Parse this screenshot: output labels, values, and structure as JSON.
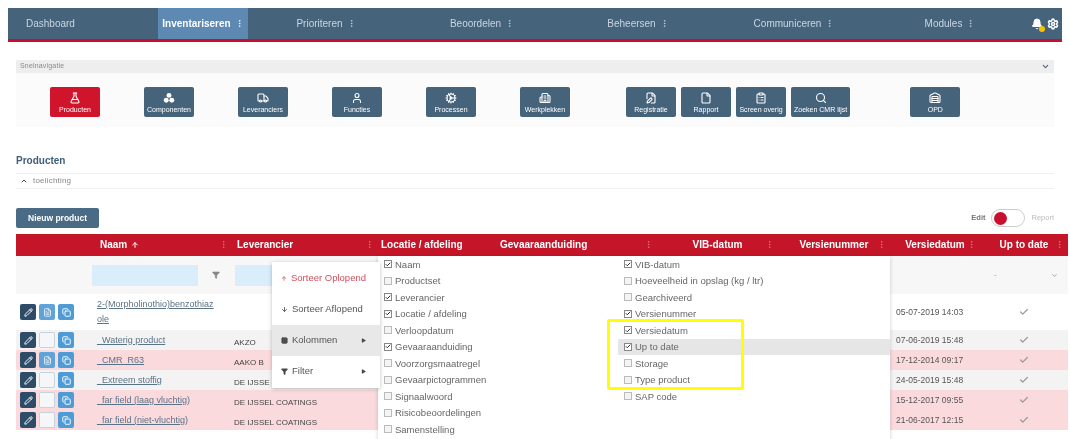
{
  "nav": {
    "items": [
      {
        "label": "Dashboard",
        "selected": false,
        "menu": false
      },
      {
        "label": "Inventariseren",
        "selected": true,
        "menu": true
      },
      {
        "label": "Prioriteren",
        "selected": false,
        "menu": true
      },
      {
        "label": "Beoordelen",
        "selected": false,
        "menu": true
      },
      {
        "label": "Beheersen",
        "selected": false,
        "menu": true
      },
      {
        "label": "Communiceren",
        "selected": false,
        "menu": true
      },
      {
        "label": "Modules",
        "selected": false,
        "menu": true
      }
    ],
    "notification": true
  },
  "quick_nav": {
    "title": "Snelnavigatie",
    "expanded": true,
    "groups": [
      [
        {
          "label": "Producten",
          "selected": true
        },
        {
          "label": "Componenten",
          "selected": false
        },
        {
          "label": "Leveranciers",
          "selected": false
        },
        {
          "label": "Functies",
          "selected": false
        },
        {
          "label": "Processen",
          "selected": false
        },
        {
          "label": "Werkplekken",
          "selected": false
        }
      ],
      [
        {
          "label": "Registratie",
          "selected": false
        },
        {
          "label": "Rapport",
          "selected": false
        },
        {
          "label": "Screen overig",
          "selected": false
        },
        {
          "label": "Zoeken CMR lijst",
          "selected": false
        }
      ],
      [
        {
          "label": "OPD",
          "selected": false
        }
      ]
    ]
  },
  "page": {
    "title": "Producten",
    "explanation": {
      "label": "toelichting",
      "expanded": true
    },
    "new_button": "Nieuw product",
    "toggle": {
      "left": "Edit",
      "right": "Report",
      "report_mode": false
    }
  },
  "table": {
    "columns": [
      {
        "label": "Naam",
        "sorted_ascending": true,
        "menu": true
      },
      {
        "label": "Leverancier",
        "menu": true
      },
      {
        "label": "Locatie / afdeling",
        "menu": false
      },
      {
        "label": "Gevaaraanduiding",
        "menu": true
      },
      {
        "label": "VIB-datum",
        "menu": true
      },
      {
        "label": "Versienummer",
        "menu": true
      },
      {
        "label": "Versiedatum",
        "menu": true
      },
      {
        "label": "Up to date",
        "menu": true
      }
    ],
    "up_to_date_filter": "-",
    "rows": [
      {
        "name": "2-(Morpholinothio)benzothiazole",
        "version_date": "05-07-2019 14:03",
        "up_to_date": true,
        "flagged": false,
        "document": true
      },
      {
        "name": "_Waterig product",
        "supplier": "AKZO",
        "version_date": "07-06-2019 15:48",
        "up_to_date": true,
        "flagged": false,
        "document": false
      },
      {
        "name": "_CMR_R63",
        "supplier": "AAKO B",
        "version_date": "17-12-2014 09:17",
        "up_to_date": true,
        "flagged": true,
        "document": true
      },
      {
        "name": "_Extreem stoffig",
        "supplier": "DE IJSSE",
        "version_date": "24-05-2019 15:48",
        "up_to_date": true,
        "flagged": false,
        "document": false
      },
      {
        "name": "_far field (laag vluchtig)",
        "supplier": "DE IJSSEL COATINGS",
        "version_date": "15-12-2017 09:55",
        "up_to_date": true,
        "flagged": true,
        "document": false
      },
      {
        "name": "_far field (niet-vluchtig)",
        "supplier": "DE IJSSEL COATINGS",
        "version_date": "21-06-2017 12:15",
        "up_to_date": true,
        "flagged": true,
        "document": false
      }
    ]
  },
  "context_menu": {
    "items": [
      {
        "label": "Sorteer Oplopend",
        "kind": "sort-asc",
        "selected": false,
        "active": true
      },
      {
        "label": "Sorteer Aflopend",
        "kind": "sort-desc",
        "selected": false,
        "active": false
      },
      {
        "label": "Kolommen",
        "kind": "columns",
        "selected": true,
        "active": false
      },
      {
        "label": "Filter",
        "kind": "filter",
        "selected": false,
        "active": false
      }
    ]
  },
  "columns_panel": {
    "lists": [
      [
        {
          "label": "Naam",
          "checked": true,
          "selected": false
        },
        {
          "label": "Productset",
          "checked": false,
          "selected": false
        },
        {
          "label": "Leverancier",
          "checked": true,
          "selected": false
        },
        {
          "label": "Locatie / afdeling",
          "checked": true,
          "selected": false
        },
        {
          "label": "Verloopdatum",
          "checked": false,
          "selected": false
        },
        {
          "label": "Gevaaraanduiding",
          "checked": true,
          "selected": false
        },
        {
          "label": "Voorzorgsmaatregel",
          "checked": false,
          "selected": false
        },
        {
          "label": "Gevaarpictogrammen",
          "checked": false,
          "selected": false
        },
        {
          "label": "Signaalwoord",
          "checked": false,
          "selected": false
        },
        {
          "label": "Risicobeoordelingen",
          "checked": false,
          "selected": false
        },
        {
          "label": "Samenstelling",
          "checked": false,
          "selected": false
        }
      ],
      [
        {
          "label": "VIB-datum",
          "checked": true,
          "selected": false
        },
        {
          "label": "Hoeveelheid in opslag (kg / ltr)",
          "checked": false,
          "selected": false
        },
        {
          "label": "Gearchiveerd",
          "checked": false,
          "selected": false
        },
        {
          "label": "Versienummer",
          "checked": true,
          "selected": false
        },
        {
          "label": "Versiedatum",
          "checked": true,
          "selected": false
        },
        {
          "label": "Up to date",
          "checked": true,
          "selected": true
        },
        {
          "label": "Storage",
          "checked": false,
          "selected": false
        },
        {
          "label": "Type product",
          "checked": false,
          "selected": false
        },
        {
          "label": "SAP code",
          "checked": false,
          "selected": false
        }
      ]
    ]
  },
  "annotation": {
    "kind": "highlight-frame"
  }
}
